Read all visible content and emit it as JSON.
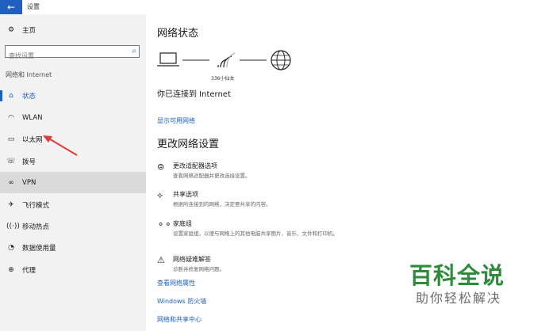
{
  "window": {
    "title": "设置",
    "back_icon": "arrow-left-icon"
  },
  "sidebar": {
    "home_label": "主页",
    "search": {
      "placeholder": "查找设置"
    },
    "section_label": "网络和 Internet",
    "items": [
      {
        "label": "状态",
        "icon": "status-icon",
        "active": true
      },
      {
        "label": "WLAN",
        "icon": "wifi-icon"
      },
      {
        "label": "以太网",
        "icon": "ethernet-icon"
      },
      {
        "label": "拨号",
        "icon": "dialup-icon"
      },
      {
        "label": "VPN",
        "icon": "vpn-icon",
        "selected": true
      },
      {
        "label": "飞行模式",
        "icon": "airplane-icon"
      },
      {
        "label": "移动热点",
        "icon": "hotspot-icon"
      },
      {
        "label": "数据使用量",
        "icon": "data-usage-icon"
      },
      {
        "label": "代理",
        "icon": "globe-icon"
      }
    ]
  },
  "main": {
    "status_title": "网络状态",
    "network_name": "336小仙女",
    "connected_text": "你已连接到 Internet",
    "show_networks_link": "显示可用网络",
    "change_title": "更改网络设置",
    "options": [
      {
        "title": "更改适配器选项",
        "desc": "查看网络适配器并更改连接设置。",
        "icon": "adapter-icon"
      },
      {
        "title": "共享选项",
        "desc": "根据所连接到的网络，决定要共享的内容。",
        "icon": "share-icon"
      },
      {
        "title": "家庭组",
        "desc": "设置家庭组，以便与网络上的其他电脑共享图片、音乐、文件和打印机。",
        "icon": "homegroup-icon"
      },
      {
        "title": "网络疑难解答",
        "desc": "诊断并修复网络问题。",
        "icon": "warning-icon"
      }
    ],
    "links": [
      "查看网络属性",
      "Windows 防火墙",
      "网络和共享中心"
    ]
  },
  "watermark": {
    "main": "百科全说",
    "sub": "助你轻松解决"
  },
  "colors": {
    "accent": "#1f5fbf",
    "sidebar_bg": "#f2f2f2",
    "watermark": "#2e8b3c",
    "arrow": "#e03a3a"
  }
}
